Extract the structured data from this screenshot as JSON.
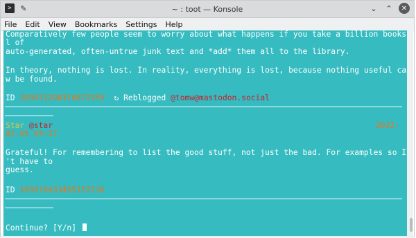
{
  "window": {
    "title": "~ : toot — Konsole",
    "icons": {
      "app": "konsole-app-icon",
      "pin": "pin-icon",
      "minimize": "chevron-down-icon",
      "maximize": "chevron-up-icon",
      "close": "close-icon"
    }
  },
  "menu": [
    "File",
    "Edit",
    "View",
    "Bookmarks",
    "Settings",
    "Help"
  ],
  "terminal": {
    "lines": {
      "l1": "Comparatively few people seem to worry about what happens if you take a billion books ful",
      "l2": "l of",
      "l3": "auto-generated, often-untrue junk text and *add* them all to the library.",
      "l4": "In theory, nothing is lost. In reality, everything is lost, because nothing useful can no",
      "l5": "w be found."
    },
    "toot1": {
      "id_label": "ID",
      "id": "109031208316872959",
      "reblog_icon": "↻",
      "reblog_text": "Reblogged",
      "reblogged_by": "@tomw@mastodon.social"
    },
    "toot2": {
      "name": "Star",
      "handle": "@star",
      "date_part1": "2022-",
      "date_part2": "02-05 05:27",
      "text1": "Grateful! For remembering to list the good stuff, not just the bad. For examples so I don",
      "text2": "'t have to",
      "text3": "guess.",
      "id_label": "ID",
      "id": "109010433455157236"
    },
    "prompt": "Continue? [Y/n] "
  },
  "colors": {
    "terminal_bg": "#36bcc0",
    "accent_orange": "#e6751c",
    "accent_red": "#c8202b",
    "text": "#ffffff"
  }
}
